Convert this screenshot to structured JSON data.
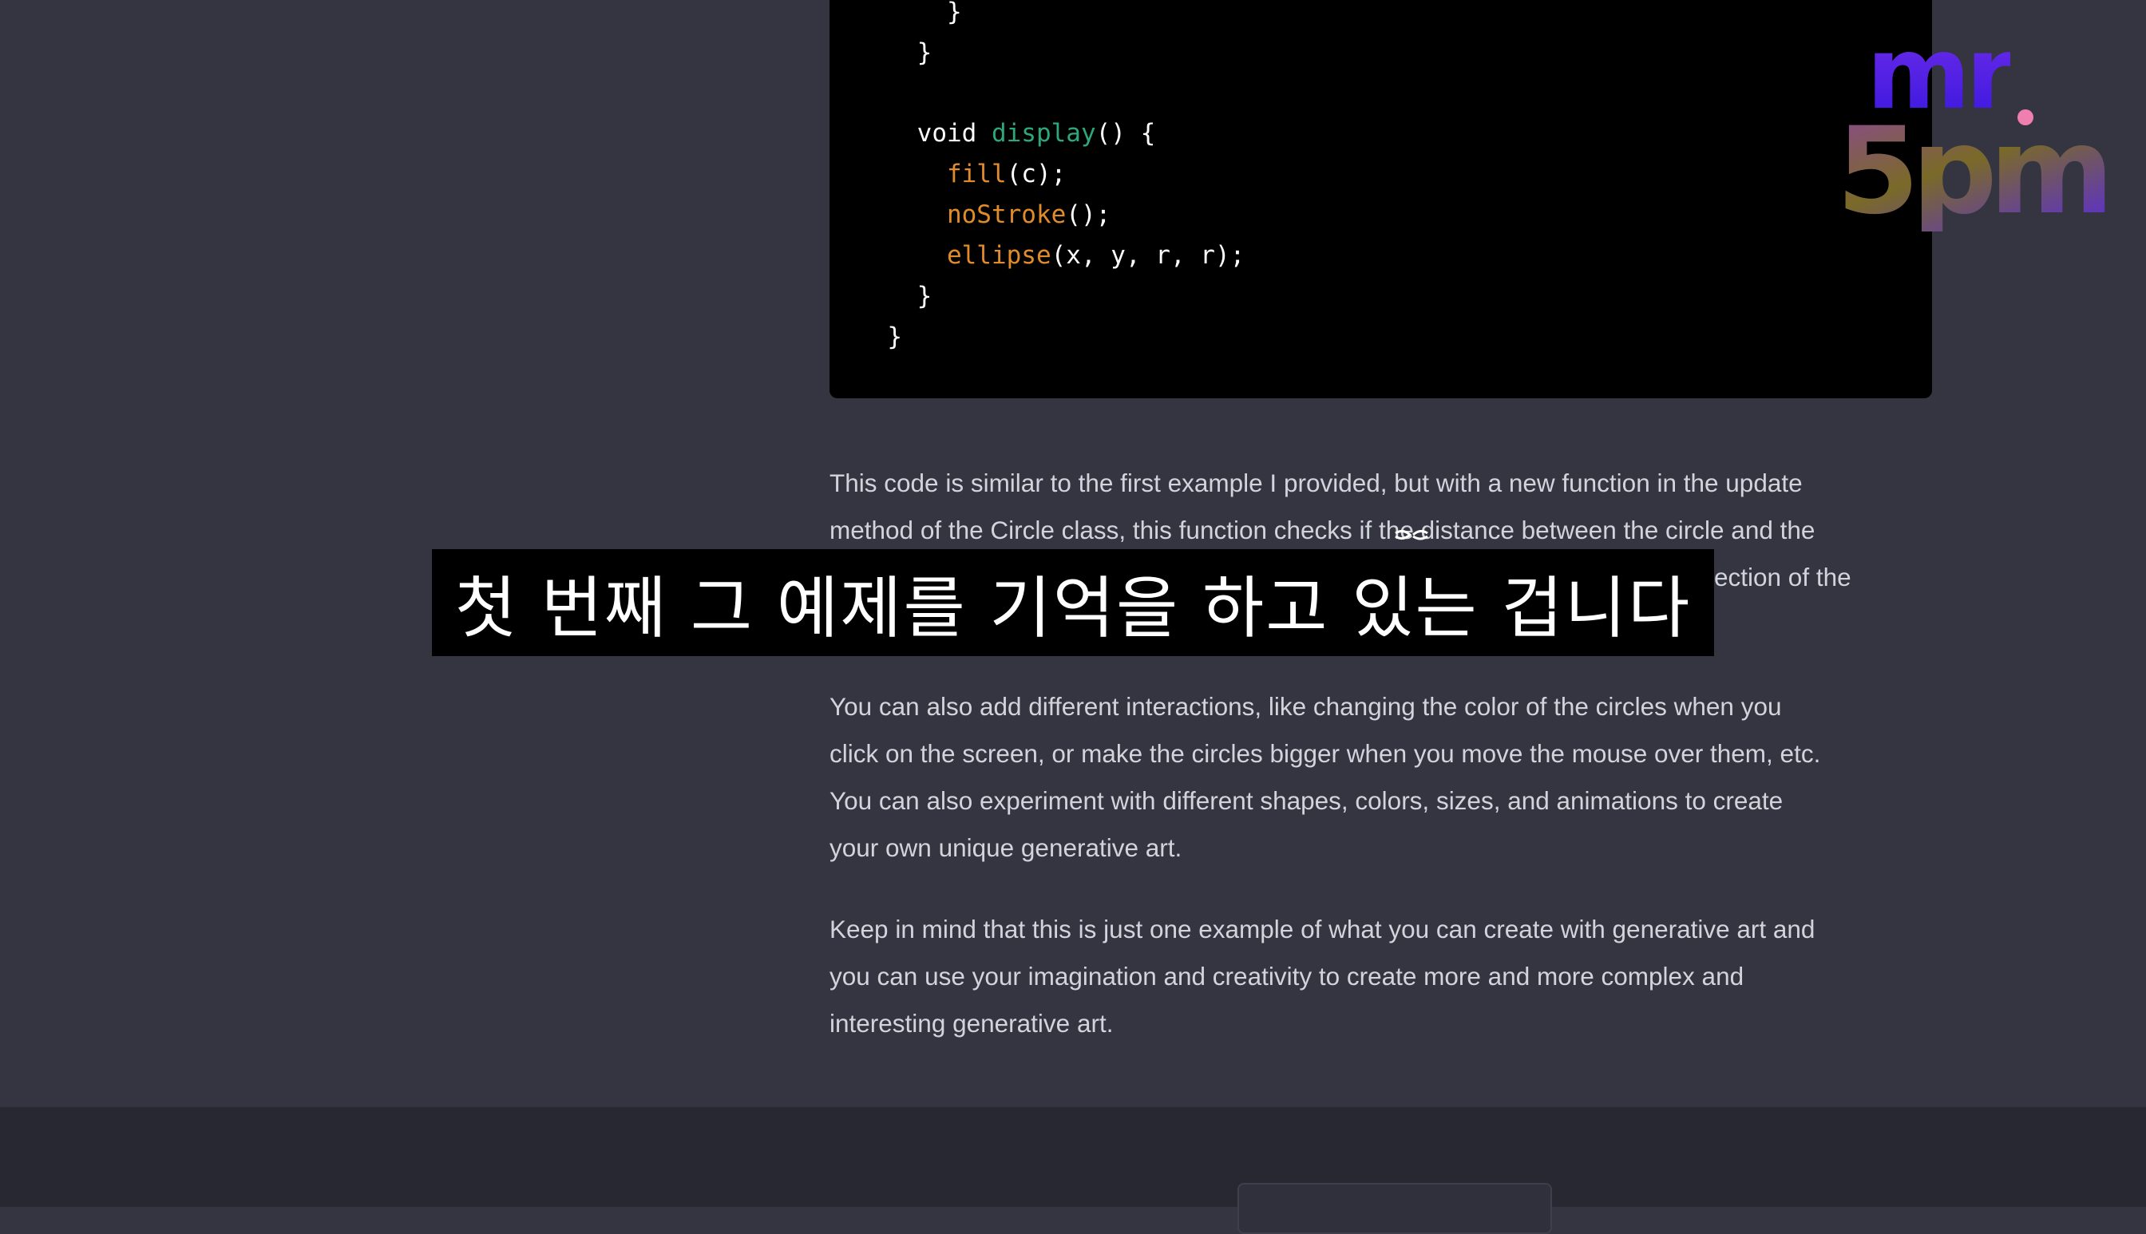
{
  "code": {
    "lines": [
      [
        {
          "t": "      }",
          "c": "plain"
        }
      ],
      [
        {
          "t": "    }",
          "c": "plain"
        }
      ],
      [
        {
          "t": "",
          "c": "plain"
        }
      ],
      [
        {
          "t": "    void ",
          "c": "kw"
        },
        {
          "t": "display",
          "c": "fn"
        },
        {
          "t": "() {",
          "c": "plain"
        }
      ],
      [
        {
          "t": "      ",
          "c": "plain"
        },
        {
          "t": "fill",
          "c": "call"
        },
        {
          "t": "(c);",
          "c": "plain"
        }
      ],
      [
        {
          "t": "      ",
          "c": "plain"
        },
        {
          "t": "noStroke",
          "c": "call"
        },
        {
          "t": "();",
          "c": "plain"
        }
      ],
      [
        {
          "t": "      ",
          "c": "plain"
        },
        {
          "t": "ellipse",
          "c": "call"
        },
        {
          "t": "(x, y, r, r);",
          "c": "plain"
        }
      ],
      [
        {
          "t": "    }",
          "c": "plain"
        }
      ],
      [
        {
          "t": "  }",
          "c": "plain"
        }
      ]
    ]
  },
  "response": {
    "paragraph1_line1": "This code is similar to the first example I provided, but with a new function in the update",
    "paragraph1_line2": "method of the Circle class, this function checks if the distance between the circle and the",
    "paragraph1_line3_tail": "ection of the",
    "paragraph2": [
      "You can also add different interactions, like changing the color of the circles when you",
      "click on the screen, or make the circles bigger when you move the mouse over them, etc.",
      "You can also experiment with different shapes, colors, sizes, and animations to create",
      "your own unique generative art."
    ],
    "paragraph3": [
      "Keep in mind that this is just one example of what you can create with generative art and",
      "you can use your imagination and creativity to create more and more complex and",
      "interesting generative art."
    ]
  },
  "subtitle": {
    "text": "첫 번째 그 예제를 기억을 하고 있는 겁니다"
  },
  "logo": {
    "line1": "mr",
    "line2": "5pm"
  },
  "colors": {
    "background": "#343541",
    "code_background": "#000000",
    "function_name": "#2ea77a",
    "builtin_call": "#e28b2b",
    "body_text": "#d1d5db",
    "footer": "#282832",
    "logo_dot": "#f07fb0"
  }
}
